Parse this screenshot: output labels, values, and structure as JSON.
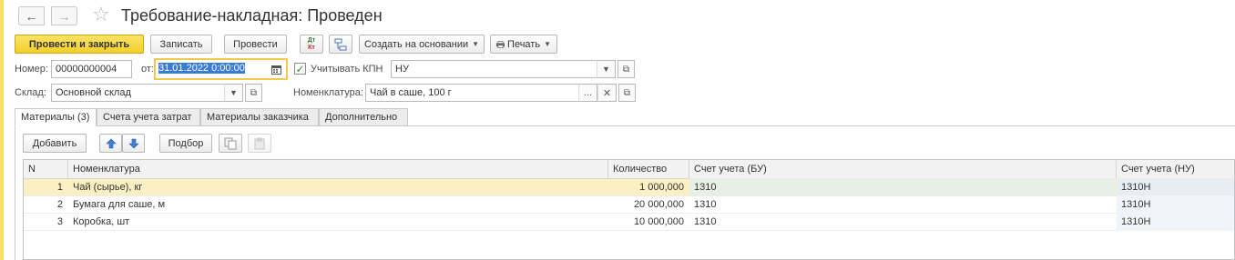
{
  "window": {
    "title": "Требование-накладная: Проведен",
    "back_glyph": "←",
    "forward_glyph": "→",
    "star_glyph": "☆"
  },
  "toolbar": {
    "post_and_close": "Провести и закрыть",
    "save": "Записать",
    "post": "Провести",
    "dt_kt_top": "Дт",
    "dt_kt_bottom": "Кт",
    "create_based_on": "Создать на основании",
    "print": "Печать"
  },
  "header": {
    "number_label": "Номер:",
    "number_value": "00000000004",
    "date_label": "от:",
    "date_value": "31.01.2022  0:00:00",
    "kpn_label": "Учитывать КПН",
    "kpn_checked": true,
    "kpn_value": "НУ",
    "warehouse_label": "Склад:",
    "warehouse_value": "Основной склад",
    "nomenclature_label": "Номенклатура:",
    "nomenclature_value": "Чай в саше, 100 г"
  },
  "tabs": [
    {
      "label": "Материалы (3)",
      "active": true
    },
    {
      "label": "Счета учета затрат",
      "active": false
    },
    {
      "label": "Материалы заказчика",
      "active": false
    },
    {
      "label": "Дополнительно",
      "active": false
    }
  ],
  "table_toolbar": {
    "add": "Добавить",
    "selection": "Подбор"
  },
  "table": {
    "columns": [
      "N",
      "Номенклатура",
      "Количество",
      "Счет учета (БУ)",
      "Счет учета (НУ)"
    ],
    "rows": [
      {
        "n": "1",
        "item": "Чай (сырье), кг",
        "qty": "1 000,000",
        "account_bu": "1310",
        "account_nu": "1310Н",
        "selected": true
      },
      {
        "n": "2",
        "item": "Бумага для саше, м",
        "qty": "20 000,000",
        "account_bu": "1310",
        "account_nu": "1310Н",
        "selected": false
      },
      {
        "n": "3",
        "item": "Коробка, шт",
        "qty": "10 000,000",
        "account_bu": "1310",
        "account_nu": "1310Н",
        "selected": false
      }
    ]
  },
  "colors": {
    "primary_button": "#f3cf2a",
    "selected_row": "#fbf0c4",
    "selection_highlight": "#3a7bd5"
  }
}
